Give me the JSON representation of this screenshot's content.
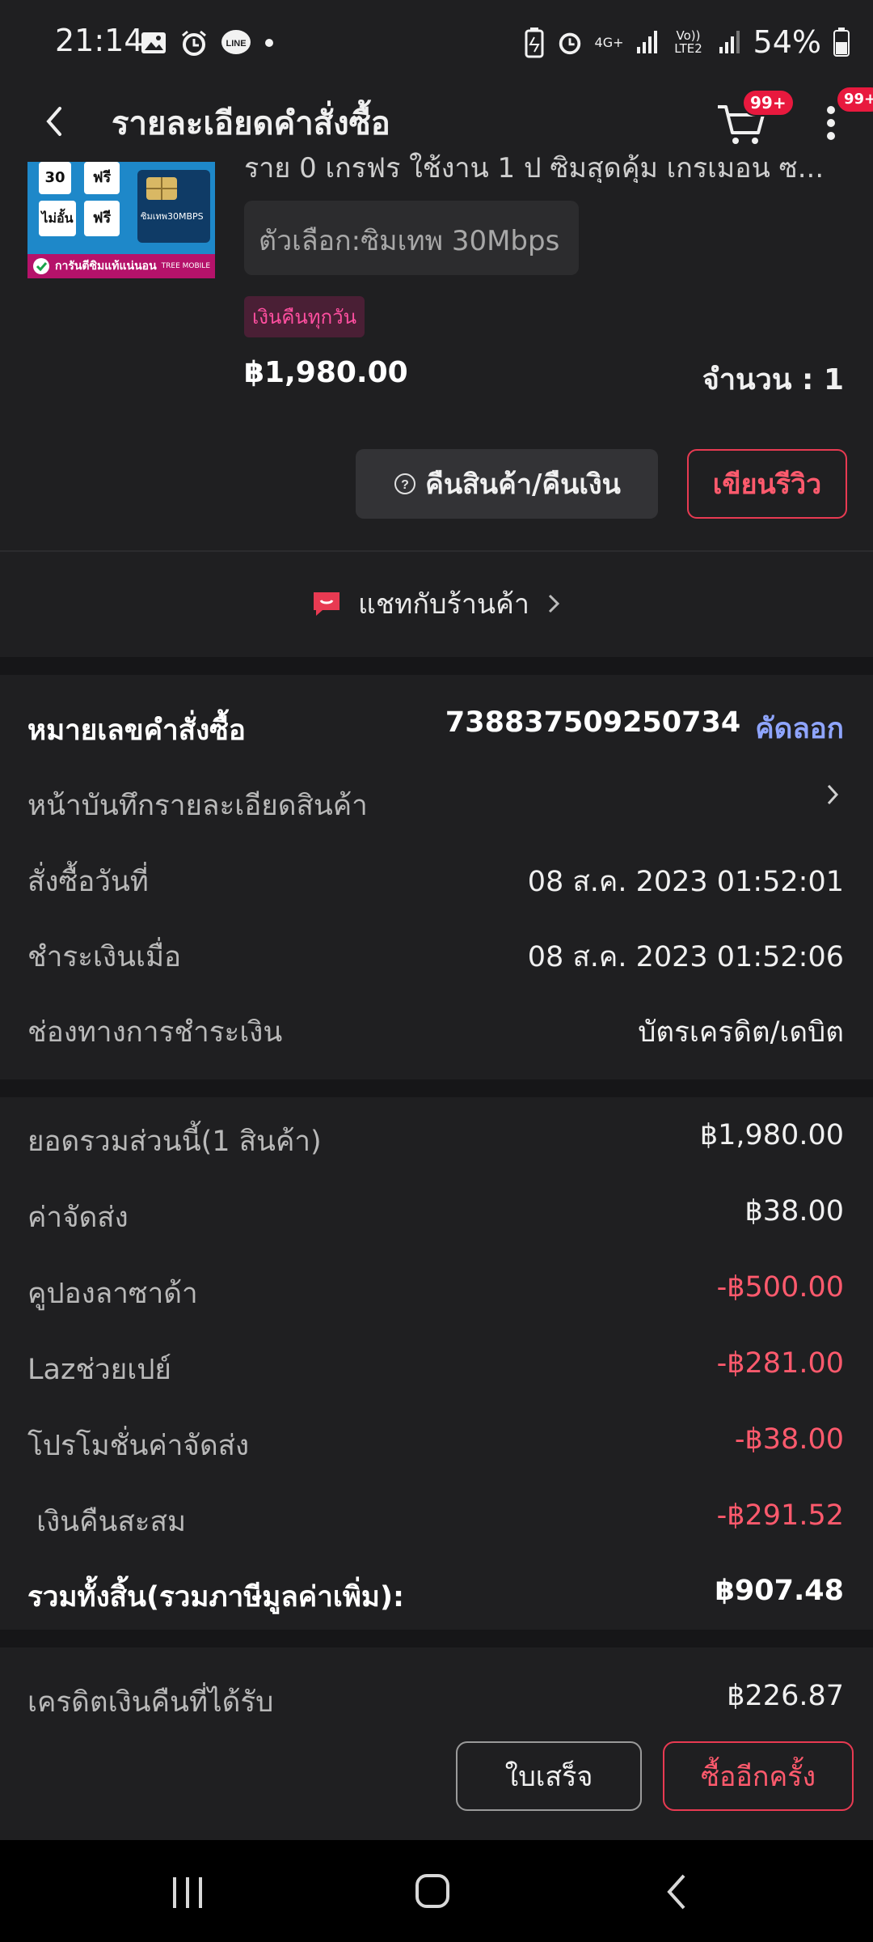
{
  "status_bar": {
    "time": "21:14",
    "network": "4G+",
    "volte": "Vo)) LTE2",
    "battery": "54%"
  },
  "header": {
    "title": "รายละเอียดคำสั่งซื้อ",
    "cart_badge": "99+",
    "menu_badge": "99+"
  },
  "product": {
    "title_partial": "ราย 0 เกรฟร ใช้งาน 1 ป ซิมสุดคุ้ม เกรเมอน ซ...",
    "variant": "ตัวเลือก:ซิมเทพ 30Mbps",
    "cashback_tag": "เงินคืนทุกวัน",
    "price": "฿1,980.00",
    "quantity": "จำนวน : 1",
    "thumb_texts": {
      "box1_a": "30",
      "box1_b": "ฟรี",
      "box2_a": "ไม่อั้น",
      "box2_b": "ฟรี",
      "sim_label": "ซิมเทพ30MBPS",
      "banner": "การันตีซิมแท้แน่นอน",
      "brand": "TREE MOBILE"
    }
  },
  "actions": {
    "return_label": "คืนสินค้า/คืนเงิน",
    "review_label": "เขียนรีวิว"
  },
  "chat": {
    "label": "แชทกับร้านค้า"
  },
  "order_info": {
    "order_number_label": "หมายเลขคำสั่งซื้อ",
    "order_number": "738837509250734",
    "copy_label": "คัดลอก",
    "snapshot_label": "หน้าบันทึกรายละเอียดสินค้า",
    "ordered_label": "สั่งซื้อวันที่",
    "ordered_value": "08 ส.ค. 2023  01:52:01",
    "paid_label": "ชำระเงินเมื่อ",
    "paid_value": "08 ส.ค. 2023  01:52:06",
    "method_label": "ช่องทางการชำระเงิน",
    "method_value": "บัตรเครดิต/เดบิต"
  },
  "summary": {
    "rows": [
      {
        "label": "ยอดรวมส่วนนี้(1 สินค้า)",
        "value": "฿1,980.00"
      },
      {
        "label": "ค่าจัดส่ง",
        "value": "฿38.00"
      },
      {
        "label": "คูปองลาซาด้า",
        "value": "-฿500.00"
      },
      {
        "label": "Lazช่วยเปย์",
        "value": "-฿281.00"
      },
      {
        "label": "โปรโมชั่นค่าจัดส่ง",
        "value": "-฿38.00"
      },
      {
        "label": " เงินคืนสะสม",
        "value": "-฿291.52"
      }
    ],
    "total_label": "รวมทั้งสิ้น(รวมภาษีมูลค่าเพิ่ม):",
    "total_value": "฿907.48",
    "credit_label": "เครดิตเงินคืนที่ได้รับ",
    "credit_value": "฿226.87"
  },
  "bottom_actions": {
    "receipt_label": "ใบเสร็จ",
    "rebuy_label": "ซื้ออีกครั้ง"
  },
  "colors": {
    "accent": "#e83a52",
    "link": "#8fa5ff",
    "background": "#1f1f21"
  }
}
